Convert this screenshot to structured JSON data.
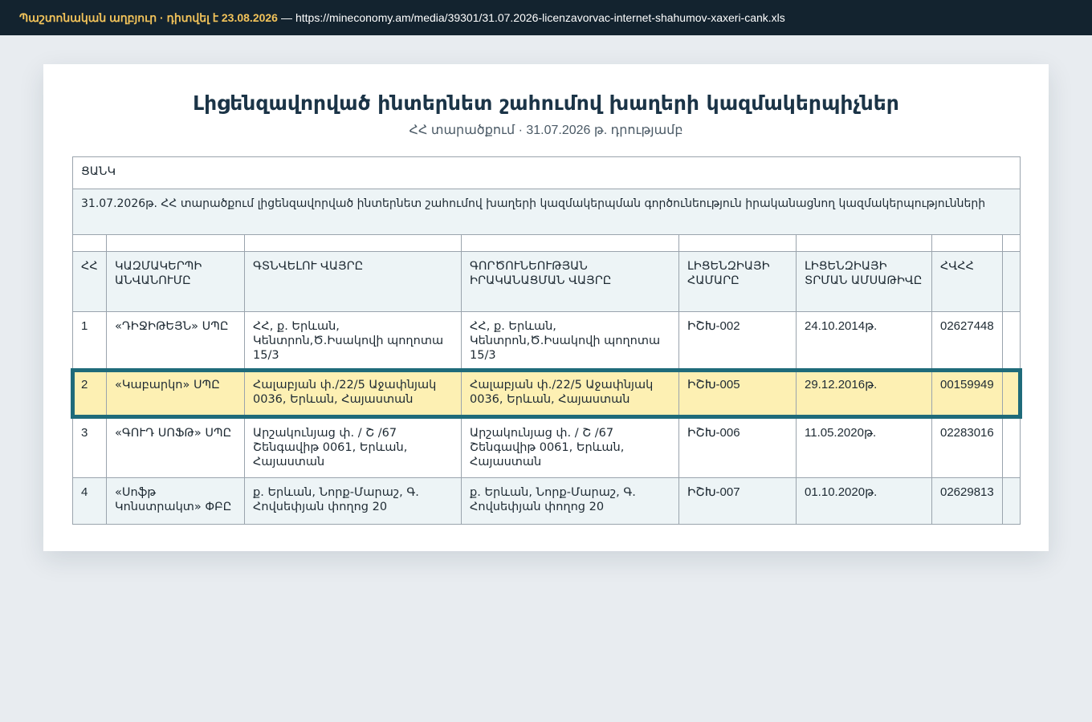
{
  "banner": {
    "source_label": "Պաշտոնական աղբյուր · դիտվել է 23.08.2026",
    "separator": "—",
    "url": "https://mineconomy.am/media/39301/31.07.2026-licenzavorvac-internet-shahumov-xaxeri-cank.xls"
  },
  "document": {
    "title": "Լիցենզավորված ինտերնետ շահումով խաղերի կազմակերպիչներ",
    "subtitle": "ՀՀ տարածքում · 31.07.2026 թ. դրությամբ"
  },
  "sheet": {
    "caption": "ՑԱՆԿ",
    "description": "31.07.2026թ. ՀՀ տարածքում լիցենզավորված ինտերնետ շահումով խաղերի կազմակերպման գործունեություն իրականացնող կազմակերպությունների",
    "headers": [
      "ՀՀ",
      "ԿԱԶՄԱԿԵՐՊԻ ԱՆՎԱՆՈՒՄԸ",
      "ԳՏՆՎԵԼՈՒ ՎԱՅՐԸ",
      "ԳՈՐԾՈՒՆԵՈՒԹՅԱՆ ԻՐԱԿԱՆԱՑՄԱՆ ՎԱՅՐԸ",
      "ԼԻՑԵՆԶԻԱՅԻ ՀԱՄԱՐԸ",
      "ԼԻՑԵՆԶԻԱՅԻ ՏՐՄԱՆ ԱՄՍԱԹԻՎԸ",
      "ՀՎՀՀ",
      ""
    ],
    "rows": [
      {
        "num": "1",
        "name": "«ԴԻՋԻԹԵՅՆ» ՍՊԸ",
        "location": "ՀՀ, ք. Երևան, Կենտրոն,Ծ.Իսակովի պողոտա 15/3",
        "activity_place": "ՀՀ, ք. Երևան, Կենտրոն,Ծ.Իսակովի պողոտա 15/3",
        "license_no": "ԻՇԽ-002",
        "issue_date": "24.10.2014թ.",
        "tin": "02627448"
      },
      {
        "num": "2",
        "name": "«Կաբարկո» ՍՊԸ",
        "location": "Հալաբյան փ./22/5 Աջափնյակ 0036, Երևան, Հայաստան",
        "activity_place": "Հալաբյան փ./22/5 Աջափնյակ 0036, Երևան, Հայաստան",
        "license_no": "ԻՇԽ-005",
        "issue_date": "29.12.2016թ.",
        "tin": "00159949"
      },
      {
        "num": "3",
        "name": "«ԳՈՒԴ ՍՈՖԹ» ՍՊԸ",
        "location": "Արշակունյաց փ. / Շ /67 Շենգավիթ 0061, Երևան, Հայաստան",
        "activity_place": "Արշակունյաց փ. / Շ /67 Շենգավիթ 0061, Երևան, Հայաստան",
        "license_no": "ԻՇԽ-006",
        "issue_date": "11.05.2020թ.",
        "tin": "02283016"
      },
      {
        "num": "4",
        "name": "«Սոֆթ Կոնստրակտ» ՓԲԸ",
        "location": "ք. Երևան, Նորք-Մարաշ, Գ. Հովսեփյան փողոց 20",
        "activity_place": "ք. Երևան, Նորք-Մարաշ, Գ. Հովսեփյան փողոց 20",
        "license_no": "ԻՇԽ-007",
        "issue_date": "01.10.2020թ.",
        "tin": "02629813"
      }
    ]
  },
  "colors": {
    "banner_bg": "#13232f",
    "banner_accent": "#f2c35a",
    "highlight_fill": "#fdf0b3",
    "highlight_border": "#1f6b7a",
    "band_fill": "#edf4f6"
  }
}
